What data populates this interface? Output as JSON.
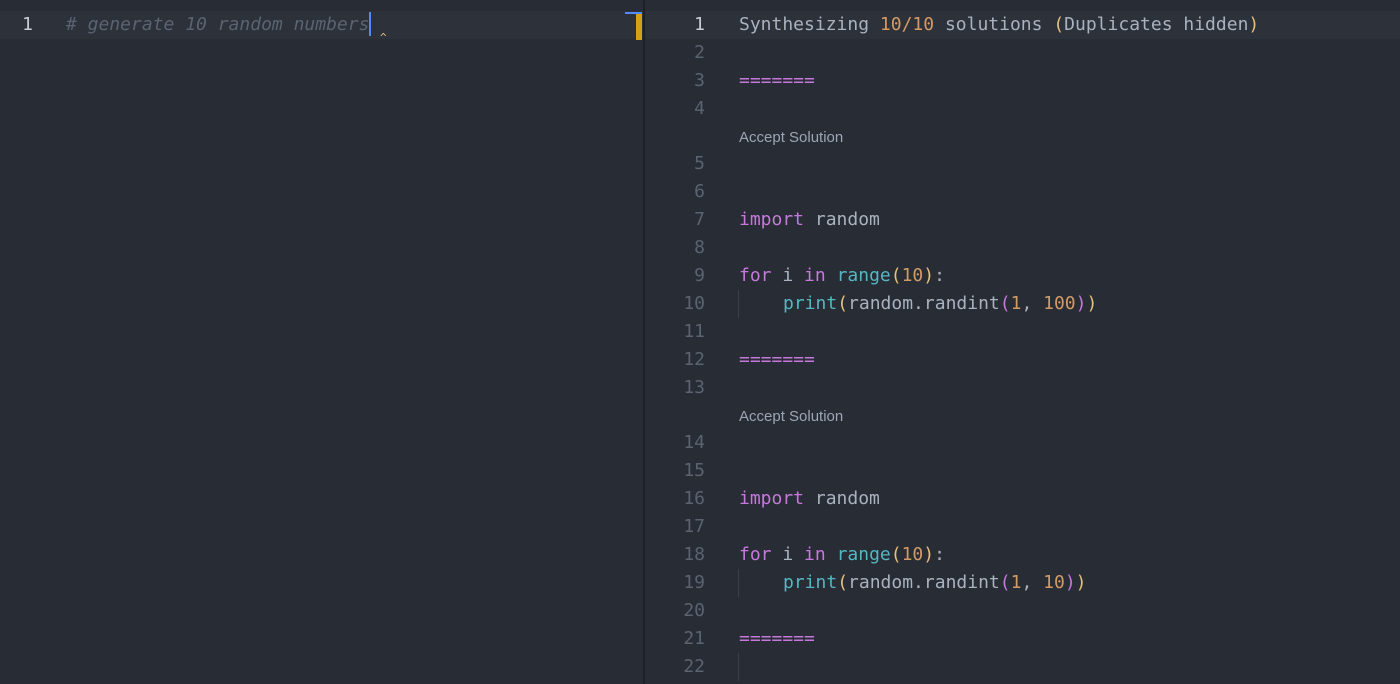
{
  "left_editor": {
    "line_number": "1",
    "comment": "# generate 10 random numbers"
  },
  "right_editor": {
    "header": {
      "prefix": "Synthesizing ",
      "count_a": "10",
      "slash": "/",
      "count_b": "10",
      "middle": " solutions ",
      "paren_open": "(",
      "paren_text": "Duplicates hidden",
      "paren_close": ")"
    },
    "separator": "=======",
    "accept_label": "Accept Solution",
    "solutions": [
      {
        "import_kw": "import",
        "import_mod": " random",
        "for_kw": "for",
        "var": " i ",
        "in_kw": "in",
        "range_fn": "range",
        "range_arg": "10",
        "colon": ":",
        "print_fn": "print",
        "call": "random.randint",
        "arg1": "1",
        "comma": ", ",
        "arg2": "100"
      },
      {
        "import_kw": "import",
        "import_mod": " random",
        "for_kw": "for",
        "var": " i ",
        "in_kw": "in",
        "range_fn": "range",
        "range_arg": "10",
        "colon": ":",
        "print_fn": "print",
        "call": "random.randint",
        "arg1": "1",
        "comma": ", ",
        "arg2": "10"
      }
    ],
    "line_numbers": [
      "1",
      "2",
      "3",
      "4",
      "5",
      "6",
      "7",
      "8",
      "9",
      "10",
      "11",
      "12",
      "13",
      "14",
      "15",
      "16",
      "17",
      "18",
      "19",
      "20",
      "21",
      "22"
    ]
  },
  "colors": {
    "background": "#282c34",
    "keyword": "#c678dd",
    "function": "#56b6c2",
    "number": "#d19a66",
    "bracket": "#e5c07b",
    "comment": "#5c6370",
    "cursor": "#528bff"
  }
}
